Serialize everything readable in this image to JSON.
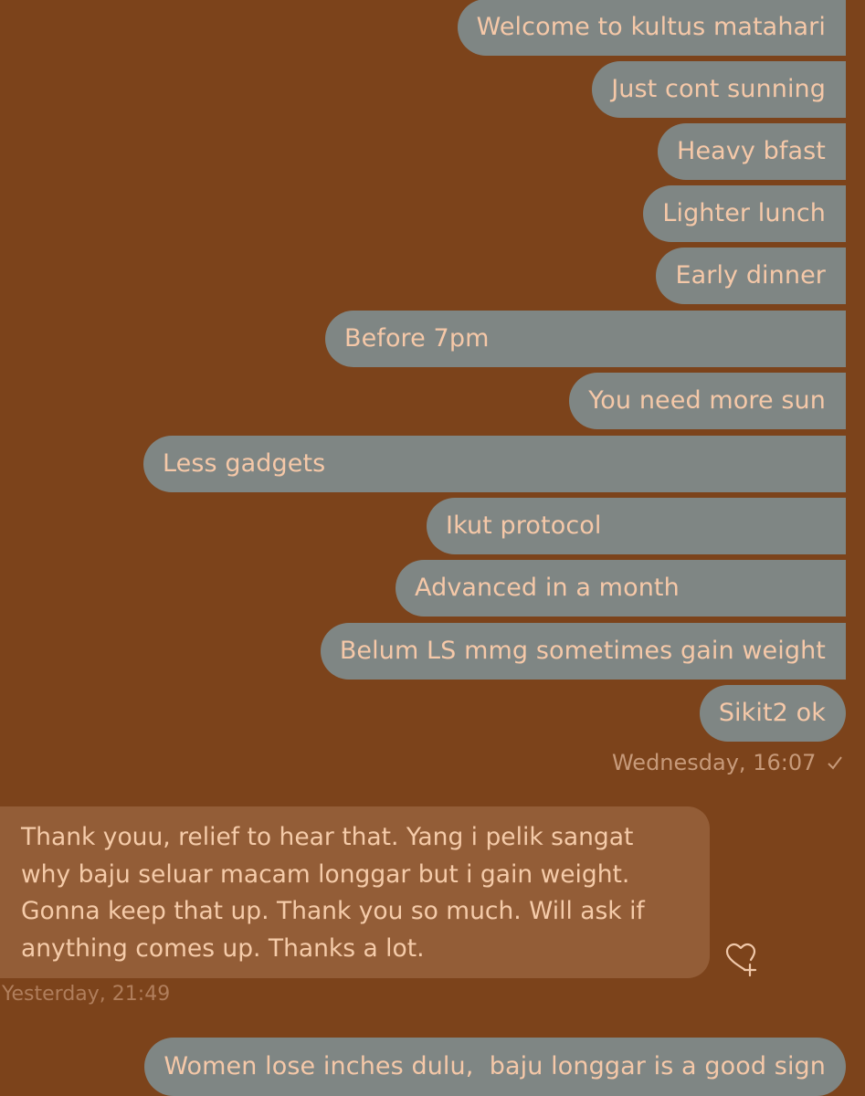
{
  "sent_messages": [
    "Welcome to kultus matahari",
    "Just cont sunning",
    "Heavy bfast",
    "Lighter lunch",
    "Early dinner",
    "Before 7pm",
    "You need more sun",
    "Less gadgets",
    "Ikut protocol",
    "Advanced in a month",
    "Belum LS mmg sometimes gain weight",
    "Sikit2 ok"
  ],
  "sent_timestamp": "Wednesday, 16:07",
  "sent_status_icon": "checkmark-icon",
  "received_message": {
    "lines": [
      "Thank youu, relief to hear that. Yang i pelik sangat",
      "why baju seluar macam longgar but i gain weight.",
      "Gonna keep that up. Thank you so much. Will ask if",
      "anything comes up. Thanks a lot."
    ]
  },
  "react_icon": "heart-plus-icon",
  "received_timestamp": "Yesterday, 21:49",
  "last_sent_message": "Women lose inches dulu,  baju longgar is a good sign",
  "colors": {
    "background": "#7c431b",
    "sent_bubble": "#7f8684",
    "received_bubble": "#935d37",
    "text": "#f5c8a8",
    "timestamp": "#c79a7a"
  }
}
